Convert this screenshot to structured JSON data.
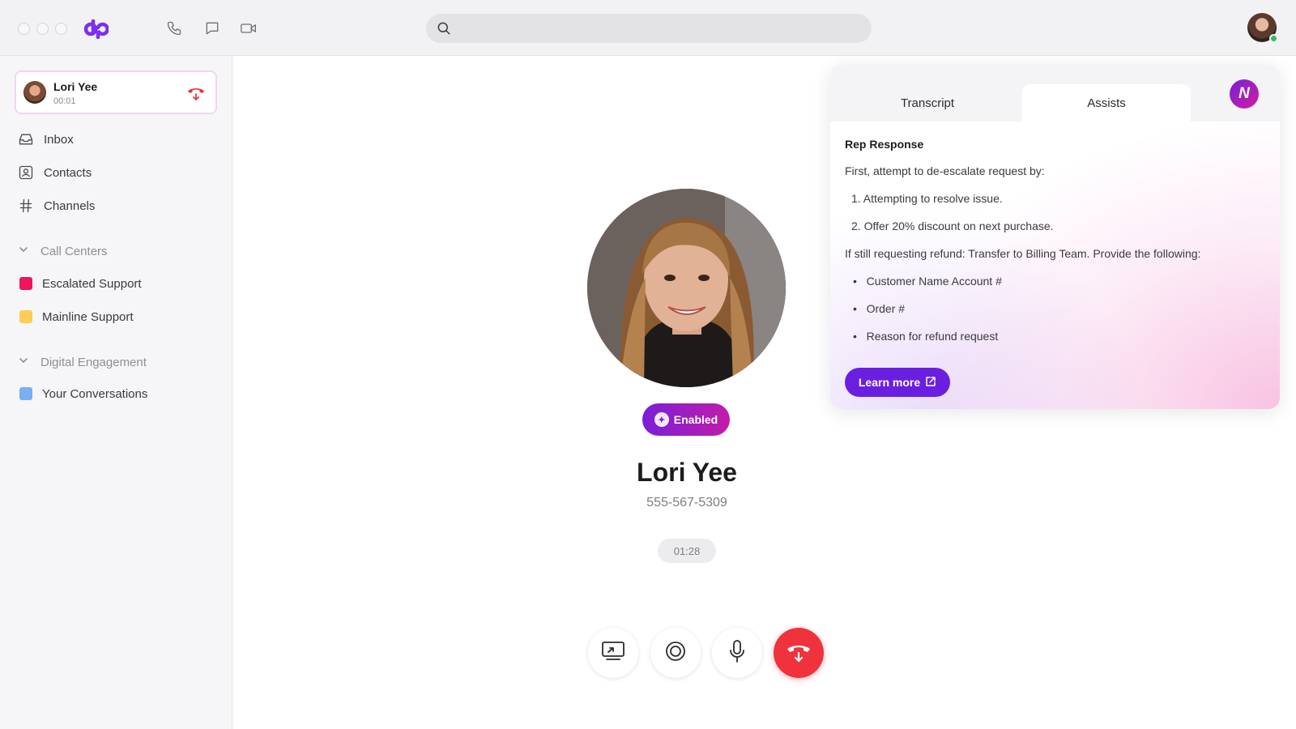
{
  "topbar": {
    "search_placeholder": "",
    "icons": [
      "phone-icon",
      "message-icon",
      "video-icon",
      "search-icon"
    ]
  },
  "sidebar": {
    "active_call": {
      "name": "Lori Yee",
      "time": "00:01"
    },
    "nav": [
      {
        "label": "Inbox",
        "icon": "inbox-icon"
      },
      {
        "label": "Contacts",
        "icon": "contacts-icon"
      },
      {
        "label": "Channels",
        "icon": "channels-icon"
      }
    ],
    "call_centers": {
      "label": "Call Centers",
      "items": [
        {
          "label": "Escalated Support",
          "color": "#f0145a"
        },
        {
          "label": "Mainline Support",
          "color": "#ffcc55"
        }
      ]
    },
    "digital_engagement": {
      "label": "Digital Engagement",
      "items": [
        {
          "label": "Your Conversations",
          "color": "#7aaef5"
        }
      ]
    }
  },
  "call": {
    "badge": "Enabled",
    "name": "Lori Yee",
    "phone": "555-567-5309",
    "duration": "01:28",
    "controls": [
      "share-screen-button",
      "record-button",
      "mute-button",
      "end-call-button"
    ]
  },
  "assist": {
    "tabs": [
      "Transcript",
      "Assists"
    ],
    "active_tab": "Assists",
    "badge": "N",
    "title": "Rep Response",
    "intro": "First, attempt to de-escalate request by:",
    "steps": [
      "1.  Attempting to resolve issue.",
      "2.  Offer 20% discount on next purchase."
    ],
    "refund_note": "If still requesting refund: Transfer to Billing Team. Provide the following:",
    "bullets": [
      "Customer Name Account #",
      "Order #",
      "Reason for refund request"
    ],
    "bullet_glyph": "•",
    "button": "Learn more"
  },
  "colors": {
    "accent": "#6a1fe0",
    "end_call": "#f0323c",
    "badge_from": "#7a1fd8",
    "badge_to": "#c21ca8"
  }
}
